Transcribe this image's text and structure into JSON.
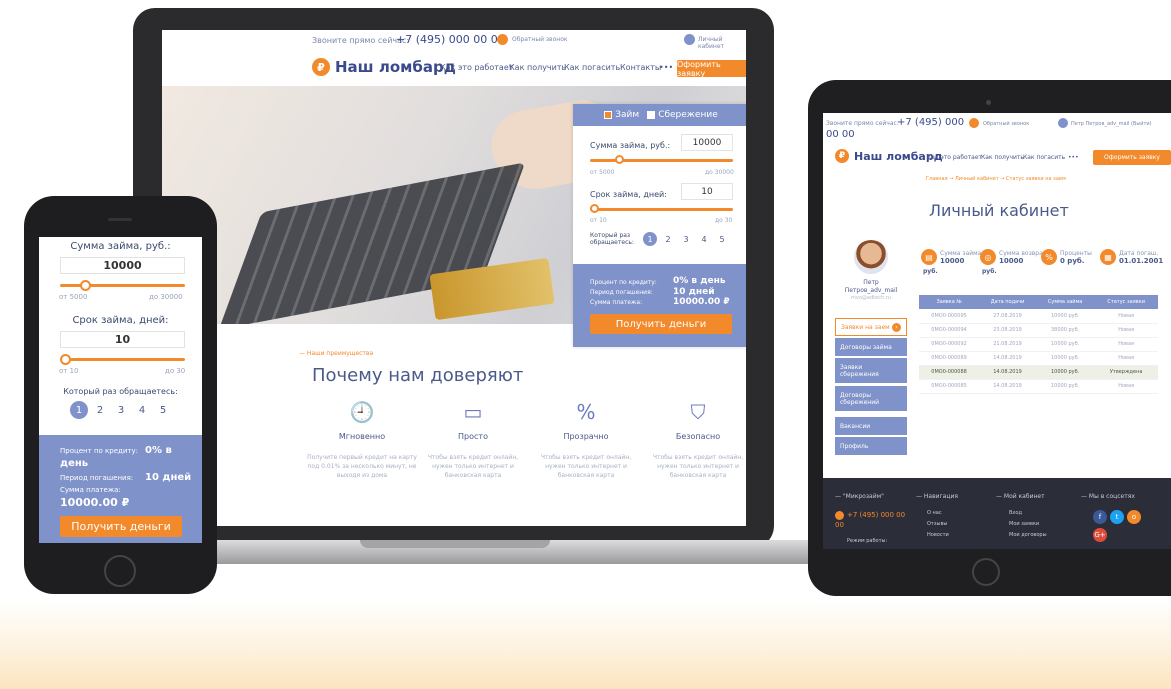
{
  "laptop": {
    "call_text": "Звоните прямо сейчас:",
    "phone": "+7 (495) 000 00 00",
    "callback": "Обратный звонок",
    "account": "Личный кабинет",
    "logo": "Наш ломбард",
    "nav": [
      "Как это работает",
      "Как получить",
      "Как погасить",
      "Контакты",
      "•••"
    ],
    "cta": "Оформить заявку",
    "calc": {
      "tab_loan": "Займ",
      "tab_savings": "Сбережение",
      "amount_label": "Сумма займа, руб.:",
      "amount_value": "10000",
      "amount_min": "от 5000",
      "amount_max": "до 30000",
      "amount_level": 0.2,
      "term_label": "Срок займа, дней:",
      "term_value": "10",
      "term_min": "от 10",
      "term_max": "до 30",
      "term_level": 0,
      "times_label": "Который раз обращаетесь:",
      "times": [
        "1",
        "2",
        "3",
        "4",
        "5"
      ],
      "times_selected": 1,
      "rate_label": "Процент по кредиту:",
      "rate_value": "0% в день",
      "period_label": "Период погашения:",
      "period_value": "10 дней",
      "payment_label": "Сумма платежа:",
      "payment_value": "10000.00 ₽",
      "submit": "Получить деньги"
    },
    "advantages_kicker": "— Наши преимущества",
    "advantages_title": "Почему нам доверяют",
    "features": [
      {
        "icon": "clock-icon",
        "title": "Мгновенно",
        "text": "Получите первый кредит на карту под 0.01% за несколько минут, не выходя из дома"
      },
      {
        "icon": "card-icon",
        "title": "Просто",
        "text": "Чтобы взять кредит онлайн, нужен только интернет и банковская карта"
      },
      {
        "icon": "percent-icon",
        "title": "Прозрачно",
        "text": "Чтобы взять кредит онлайн, нужен только интернет и банковская карта"
      },
      {
        "icon": "shield-check-icon",
        "title": "Безопасно",
        "text": "Чтобы взять кредит онлайн, нужен только интернет и банковская карта"
      }
    ]
  },
  "phone": {
    "amount_label": "Сумма займа, руб.:",
    "amount_value": "10000",
    "amount_min": "от 5000",
    "amount_max": "до 30000",
    "term_label": "Срок займа, дней:",
    "term_value": "10",
    "term_min": "от 10",
    "term_max": "до 30",
    "times_label": "Который раз обращаетесь:",
    "times": [
      "1",
      "2",
      "3",
      "4",
      "5"
    ],
    "rate_label": "Процент по кредиту:",
    "rate_value": "0% в",
    "rate_value2": "день",
    "period_label": "Период погашения:",
    "period_value": "10 дней",
    "payment_label": "Сумма платежа:",
    "payment_value": "10000.00 ₽",
    "submit": "Получить деньги"
  },
  "tablet": {
    "call_text": "Звоните прямо сейчас:",
    "phone": "+7 (495) 000",
    "phone2": "00 00",
    "callback": "Обратный звонок",
    "user_top": "Петр Петров_adv_mail (Выйти)",
    "logo": "Наш ломбард",
    "nav": [
      "Как это работает",
      "Как получить",
      "Как погасить",
      "•••"
    ],
    "cta": "Оформить заявку",
    "breadcrumb": "Главная → Личный кабинет → Статус заявки на заем",
    "title": "Личный кабинет",
    "user_name": "Петр",
    "user_login": "Петров_adv_mail",
    "user_email": "mvo@adtech.ru",
    "stats": [
      {
        "label": "Сумма займа",
        "value": "10000",
        "unit": "руб."
      },
      {
        "label": "Сумма возврата",
        "value": "10000",
        "unit": "руб."
      },
      {
        "label": "Проценты",
        "value": "0 руб."
      },
      {
        "label": "Дата погаш.",
        "value": "01.01.2001"
      }
    ],
    "menu": [
      "Заявки на заем",
      "Договоры займа",
      "Заявки сбережения",
      "Договоры сбережений",
      "Вакансии",
      "Профиль"
    ],
    "table_headers": [
      "Заявка №",
      "Дата подачи",
      "Сумма займа",
      "Статус заявки"
    ],
    "rows": [
      [
        "0МО0-000095",
        "27.08.2019",
        "10000 руб.",
        "Новая"
      ],
      [
        "0МО0-000094",
        "23.08.2019",
        "38000 руб.",
        "Новая"
      ],
      [
        "0МО0-000092",
        "21.08.2019",
        "10000 руб.",
        "Новая"
      ],
      [
        "0МО0-000089",
        "14.08.2019",
        "10000 руб.",
        "Новая"
      ],
      [
        "0МО0-000088",
        "14.08.2019",
        "10000 руб.",
        "Утверждена"
      ],
      [
        "0МО0-000085",
        "14.08.2019",
        "10000 руб.",
        "Новая"
      ]
    ],
    "footer": {
      "col1_title": "— \"Микрозайм\"",
      "col1_phone": "+7 (495) 000 00",
      "col1_phone2": "00",
      "col1_hours": "Режим работы:",
      "col2_title": "— Навигация",
      "col2_items": [
        "О нас",
        "Отзывы",
        "Новости"
      ],
      "col3_title": "— Мой кабинет",
      "col3_items": [
        "Вход",
        "Мои заявки",
        "Мои договоры"
      ],
      "col4_title": "— Мы в соцсетях"
    }
  },
  "colors": {
    "accent": "#f28a2c",
    "primary": "#7f92c9",
    "text": "#4a5a8a"
  }
}
